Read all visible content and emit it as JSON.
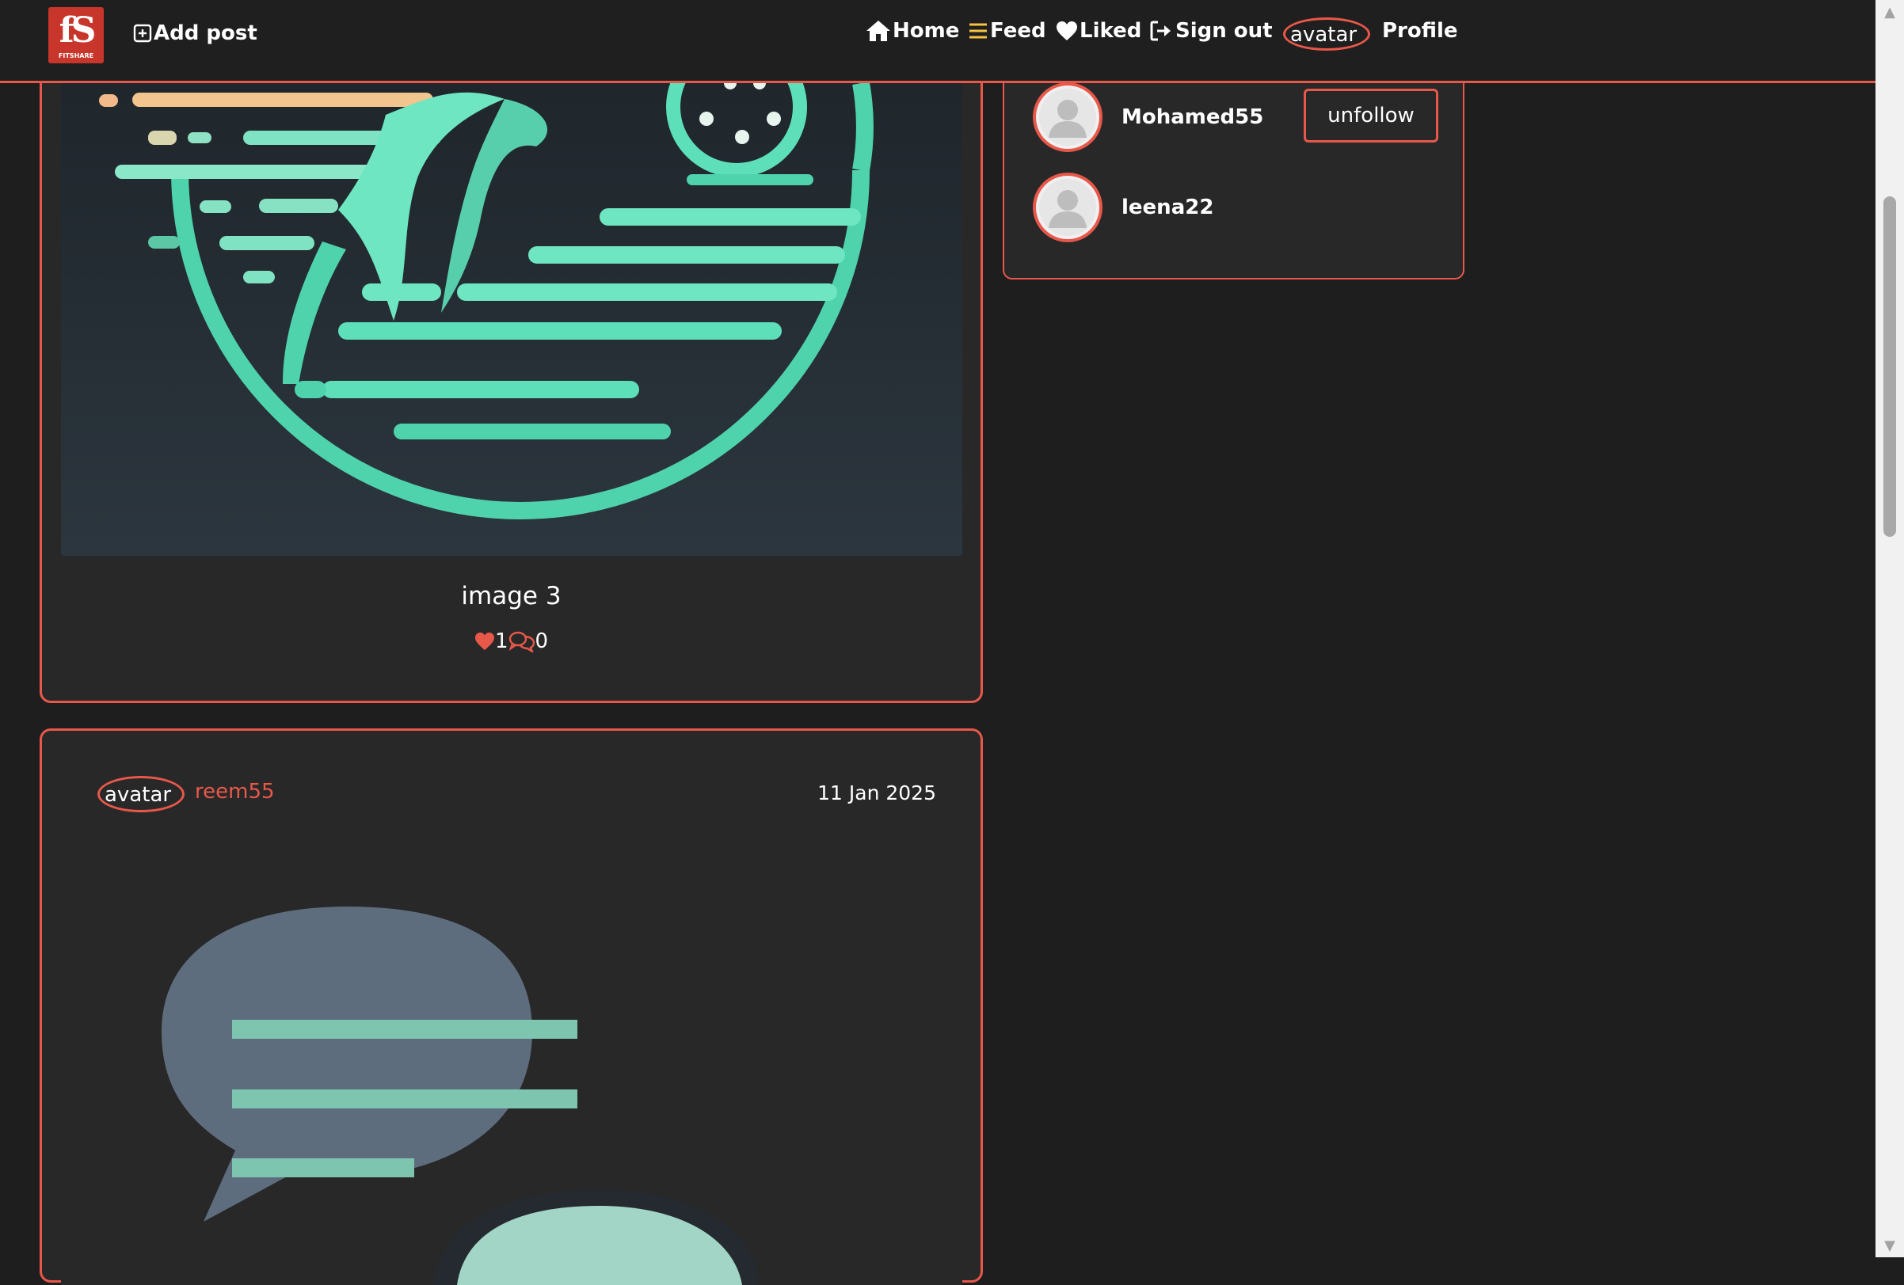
{
  "navbar": {
    "brand": "FITSHARE",
    "add_post": "Add post",
    "home": "Home",
    "feed": "Feed",
    "liked": "Liked",
    "sign_out": "Sign out",
    "avatar_alt": "avatar",
    "profile": "Profile"
  },
  "following": {
    "users": [
      {
        "username": "Mohamed55",
        "action": "unfollow"
      },
      {
        "username": "leena22"
      }
    ]
  },
  "posts": [
    {
      "title": "image 3",
      "likes": "1",
      "comments": "0"
    },
    {
      "author_avatar_alt": "avatar",
      "author": "reem55",
      "date": "11 Jan 2025"
    }
  ],
  "colors": {
    "background": "#1e1e1e",
    "card": "#282828",
    "accent": "#e8584a",
    "feed_icon": "#f5c242",
    "post_image_teal": "#5de0b9"
  },
  "icons": {
    "add_post": "plus-square-icon",
    "home": "home-icon",
    "feed": "list-icon",
    "liked": "heart-icon",
    "sign_out": "sign-out-icon",
    "like": "heart-icon",
    "comment": "comments-icon"
  }
}
